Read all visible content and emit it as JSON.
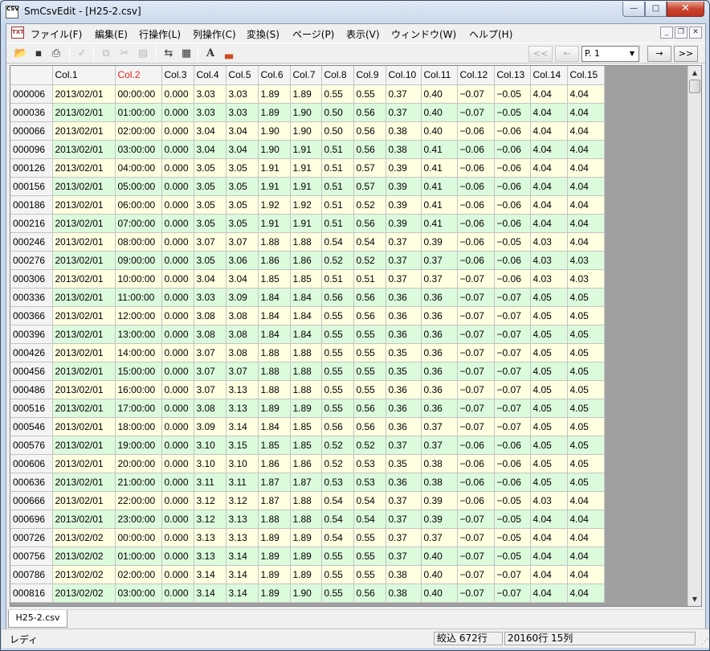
{
  "window": {
    "title": "SmCsvEdit - [H25-2.csv]"
  },
  "menu": [
    "ファイル(F)",
    "編集(E)",
    "行操作(L)",
    "列操作(C)",
    "変換(S)",
    "ページ(P)",
    "表示(V)",
    "ウィンドウ(W)",
    "ヘルプ(H)"
  ],
  "toolbar": {
    "page_value": "P. 1",
    "nav": {
      "first": "<<",
      "prev": "←",
      "next": "→",
      "last": ">>"
    }
  },
  "grid": {
    "columns": [
      "Col.1",
      "Col.2",
      "Col.3",
      "Col.4",
      "Col.5",
      "Col.6",
      "Col.7",
      "Col.8",
      "Col.9",
      "Col.10",
      "Col.11",
      "Col.12",
      "Col.13",
      "Col.14",
      "Col.15"
    ],
    "active_column": "Col.2",
    "rows": [
      [
        "000006",
        "2013/02/01",
        "00:00:00",
        "0.000",
        "3.03",
        "3.03",
        "1.89",
        "1.89",
        "0.55",
        "0.55",
        "0.37",
        "0.40",
        "−0.07",
        "−0.05",
        "4.04",
        "4.04"
      ],
      [
        "000036",
        "2013/02/01",
        "01:00:00",
        "0.000",
        "3.03",
        "3.03",
        "1.89",
        "1.90",
        "0.50",
        "0.56",
        "0.37",
        "0.40",
        "−0.07",
        "−0.05",
        "4.04",
        "4.04"
      ],
      [
        "000066",
        "2013/02/01",
        "02:00:00",
        "0.000",
        "3.04",
        "3.04",
        "1.90",
        "1.90",
        "0.50",
        "0.56",
        "0.38",
        "0.40",
        "−0.06",
        "−0.06",
        "4.04",
        "4.04"
      ],
      [
        "000096",
        "2013/02/01",
        "03:00:00",
        "0.000",
        "3.04",
        "3.04",
        "1.90",
        "1.91",
        "0.51",
        "0.56",
        "0.38",
        "0.41",
        "−0.06",
        "−0.06",
        "4.04",
        "4.04"
      ],
      [
        "000126",
        "2013/02/01",
        "04:00:00",
        "0.000",
        "3.05",
        "3.05",
        "1.91",
        "1.91",
        "0.51",
        "0.57",
        "0.39",
        "0.41",
        "−0.06",
        "−0.06",
        "4.04",
        "4.04"
      ],
      [
        "000156",
        "2013/02/01",
        "05:00:00",
        "0.000",
        "3.05",
        "3.05",
        "1.91",
        "1.91",
        "0.51",
        "0.57",
        "0.39",
        "0.41",
        "−0.06",
        "−0.06",
        "4.04",
        "4.04"
      ],
      [
        "000186",
        "2013/02/01",
        "06:00:00",
        "0.000",
        "3.05",
        "3.05",
        "1.92",
        "1.92",
        "0.51",
        "0.52",
        "0.39",
        "0.41",
        "−0.06",
        "−0.06",
        "4.04",
        "4.04"
      ],
      [
        "000216",
        "2013/02/01",
        "07:00:00",
        "0.000",
        "3.05",
        "3.05",
        "1.91",
        "1.91",
        "0.51",
        "0.56",
        "0.39",
        "0.41",
        "−0.06",
        "−0.06",
        "4.04",
        "4.04"
      ],
      [
        "000246",
        "2013/02/01",
        "08:00:00",
        "0.000",
        "3.07",
        "3.07",
        "1.88",
        "1.88",
        "0.54",
        "0.54",
        "0.37",
        "0.39",
        "−0.06",
        "−0.05",
        "4.03",
        "4.04"
      ],
      [
        "000276",
        "2013/02/01",
        "09:00:00",
        "0.000",
        "3.05",
        "3.06",
        "1.86",
        "1.86",
        "0.52",
        "0.52",
        "0.37",
        "0.37",
        "−0.06",
        "−0.06",
        "4.03",
        "4.03"
      ],
      [
        "000306",
        "2013/02/01",
        "10:00:00",
        "0.000",
        "3.04",
        "3.04",
        "1.85",
        "1.85",
        "0.51",
        "0.51",
        "0.37",
        "0.37",
        "−0.07",
        "−0.06",
        "4.03",
        "4.03"
      ],
      [
        "000336",
        "2013/02/01",
        "11:00:00",
        "0.000",
        "3.03",
        "3.09",
        "1.84",
        "1.84",
        "0.56",
        "0.56",
        "0.36",
        "0.36",
        "−0.07",
        "−0.07",
        "4.05",
        "4.05"
      ],
      [
        "000366",
        "2013/02/01",
        "12:00:00",
        "0.000",
        "3.08",
        "3.08",
        "1.84",
        "1.84",
        "0.55",
        "0.56",
        "0.36",
        "0.36",
        "−0.07",
        "−0.07",
        "4.05",
        "4.05"
      ],
      [
        "000396",
        "2013/02/01",
        "13:00:00",
        "0.000",
        "3.08",
        "3.08",
        "1.84",
        "1.84",
        "0.55",
        "0.55",
        "0.36",
        "0.36",
        "−0.07",
        "−0.07",
        "4.05",
        "4.05"
      ],
      [
        "000426",
        "2013/02/01",
        "14:00:00",
        "0.000",
        "3.07",
        "3.08",
        "1.88",
        "1.88",
        "0.55",
        "0.55",
        "0.35",
        "0.36",
        "−0.07",
        "−0.07",
        "4.05",
        "4.05"
      ],
      [
        "000456",
        "2013/02/01",
        "15:00:00",
        "0.000",
        "3.07",
        "3.07",
        "1.88",
        "1.88",
        "0.55",
        "0.55",
        "0.35",
        "0.36",
        "−0.07",
        "−0.07",
        "4.05",
        "4.05"
      ],
      [
        "000486",
        "2013/02/01",
        "16:00:00",
        "0.000",
        "3.07",
        "3.13",
        "1.88",
        "1.88",
        "0.55",
        "0.55",
        "0.36",
        "0.36",
        "−0.07",
        "−0.07",
        "4.05",
        "4.05"
      ],
      [
        "000516",
        "2013/02/01",
        "17:00:00",
        "0.000",
        "3.08",
        "3.13",
        "1.89",
        "1.89",
        "0.55",
        "0.56",
        "0.36",
        "0.36",
        "−0.07",
        "−0.07",
        "4.05",
        "4.05"
      ],
      [
        "000546",
        "2013/02/01",
        "18:00:00",
        "0.000",
        "3.09",
        "3.14",
        "1.84",
        "1.85",
        "0.56",
        "0.56",
        "0.36",
        "0.37",
        "−0.07",
        "−0.07",
        "4.05",
        "4.05"
      ],
      [
        "000576",
        "2013/02/01",
        "19:00:00",
        "0.000",
        "3.10",
        "3.15",
        "1.85",
        "1.85",
        "0.52",
        "0.52",
        "0.37",
        "0.37",
        "−0.06",
        "−0.06",
        "4.05",
        "4.05"
      ],
      [
        "000606",
        "2013/02/01",
        "20:00:00",
        "0.000",
        "3.10",
        "3.10",
        "1.86",
        "1.86",
        "0.52",
        "0.53",
        "0.35",
        "0.38",
        "−0.06",
        "−0.06",
        "4.05",
        "4.05"
      ],
      [
        "000636",
        "2013/02/01",
        "21:00:00",
        "0.000",
        "3.11",
        "3.11",
        "1.87",
        "1.87",
        "0.53",
        "0.53",
        "0.36",
        "0.38",
        "−0.06",
        "−0.06",
        "4.05",
        "4.05"
      ],
      [
        "000666",
        "2013/02/01",
        "22:00:00",
        "0.000",
        "3.12",
        "3.12",
        "1.87",
        "1.88",
        "0.54",
        "0.54",
        "0.37",
        "0.39",
        "−0.06",
        "−0.05",
        "4.03",
        "4.04"
      ],
      [
        "000696",
        "2013/02/01",
        "23:00:00",
        "0.000",
        "3.12",
        "3.13",
        "1.88",
        "1.88",
        "0.54",
        "0.54",
        "0.37",
        "0.39",
        "−0.07",
        "−0.05",
        "4.04",
        "4.04"
      ],
      [
        "000726",
        "2013/02/02",
        "00:00:00",
        "0.000",
        "3.13",
        "3.13",
        "1.89",
        "1.89",
        "0.54",
        "0.55",
        "0.37",
        "0.37",
        "−0.07",
        "−0.05",
        "4.04",
        "4.04"
      ],
      [
        "000756",
        "2013/02/02",
        "01:00:00",
        "0.000",
        "3.13",
        "3.14",
        "1.89",
        "1.89",
        "0.55",
        "0.55",
        "0.37",
        "0.40",
        "−0.07",
        "−0.05",
        "4.04",
        "4.04"
      ],
      [
        "000786",
        "2013/02/02",
        "02:00:00",
        "0.000",
        "3.14",
        "3.14",
        "1.89",
        "1.89",
        "0.55",
        "0.55",
        "0.38",
        "0.40",
        "−0.07",
        "−0.07",
        "4.04",
        "4.04"
      ],
      [
        "000816",
        "2013/02/02",
        "03:00:00",
        "0.000",
        "3.14",
        "3.14",
        "1.89",
        "1.90",
        "0.55",
        "0.56",
        "0.38",
        "0.40",
        "−0.07",
        "−0.07",
        "4.04",
        "4.04"
      ]
    ]
  },
  "tab": {
    "label": "H25-2.csv"
  },
  "status": {
    "left": "レディ",
    "filter": "絞込 672行",
    "size": "20160行 15列"
  }
}
